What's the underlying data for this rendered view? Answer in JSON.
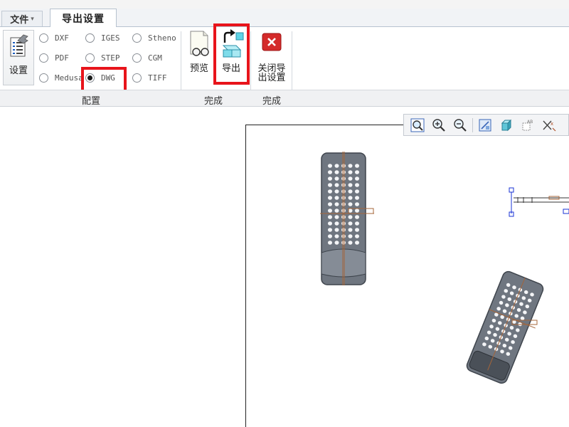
{
  "menu": {
    "file_label": "文件",
    "file_arrow": "▾"
  },
  "tabs": {
    "active_label": "导出设置"
  },
  "ribbon": {
    "settings_label": "设置",
    "formats": {
      "dxf": "DXF",
      "iges": "IGES",
      "stheno": "Stheno",
      "pdf": "PDF",
      "step": "STEP",
      "cgm": "CGM",
      "medusa": "Medusa",
      "dwg": "DWG",
      "tiff": "TIFF"
    },
    "selected_format": "DWG",
    "preview_label": "预览",
    "export_label": "导出",
    "close_label_line1": "关闭导",
    "close_label_line2": "出设置",
    "group_config_label": "配置",
    "group_done1_label": "完成",
    "group_done2_label": "完成"
  },
  "icons": {
    "settings": "settings-sheet-icon",
    "preview": "preview-glasses-icon",
    "export": "export-arrow-icon",
    "close": "close-red-x-icon"
  },
  "colors": {
    "highlight_red": "#e8141b",
    "close_red": "#d42a2a",
    "model_gray": "#6f7680",
    "datum_brown": "#a4653a",
    "selection_blue": "#1a33d6"
  }
}
